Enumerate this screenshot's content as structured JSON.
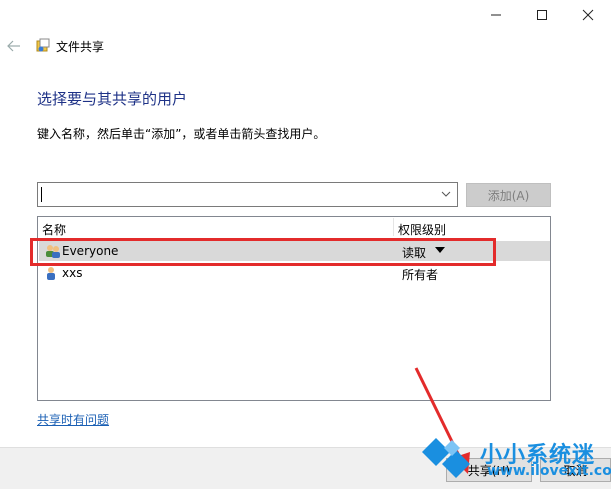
{
  "window": {
    "title": "文件共享",
    "controls": {
      "minimize": "—",
      "maximize": "☐",
      "close": "✕"
    }
  },
  "main": {
    "heading": "选择要与其共享的用户",
    "instruction": "键入名称，然后单击“添加”，或者单击箭头查找用户。",
    "name_input": {
      "value": "",
      "placeholder": ""
    },
    "add_button_label": "添加(A)",
    "table": {
      "columns": [
        "名称",
        "权限级别"
      ],
      "rows": [
        {
          "name": "Everyone",
          "permission": "读取",
          "selected": true
        },
        {
          "name": "xxs",
          "permission": "所有者",
          "selected": false
        }
      ]
    },
    "help_link": "共享时有问题"
  },
  "footer": {
    "share_button_label": "共享(H)",
    "cancel_button_label": "取消"
  },
  "watermark": {
    "brand": "小小系统迷",
    "url": "www.ilovexit.com"
  },
  "colors": {
    "heading": "#1e3287",
    "selection": "#d9d9d9",
    "annotation_red": "#e32b2b",
    "link": "#1a5fb4",
    "watermark_blue": "#1a8fe0"
  }
}
